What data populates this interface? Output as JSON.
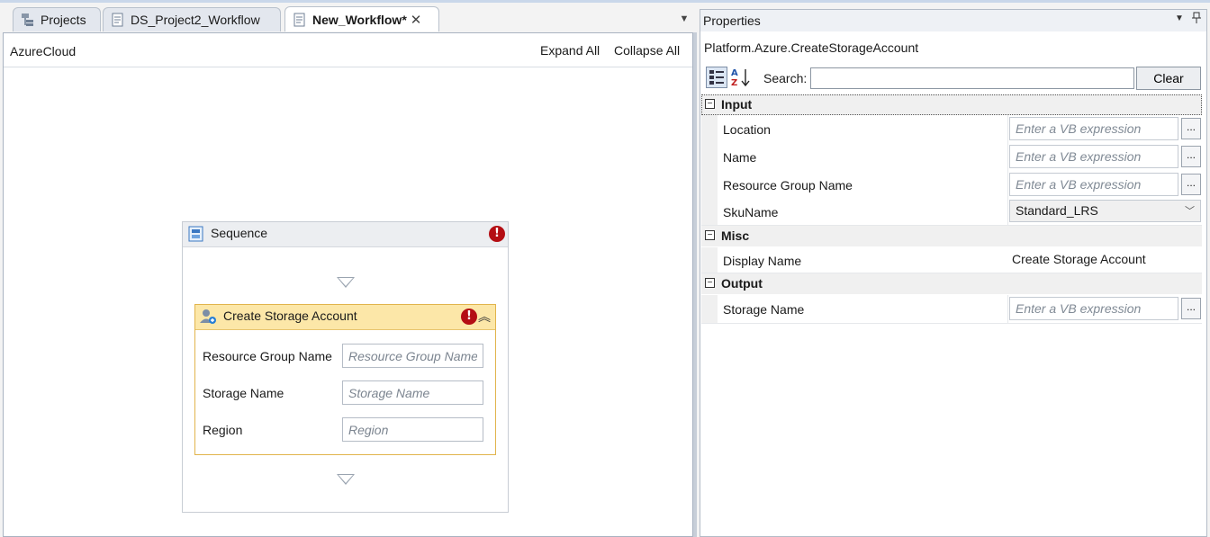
{
  "tabs": [
    {
      "label": "Projects",
      "icon": "project-explorer-icon",
      "active": false
    },
    {
      "label": "DS_Project2_Workflow",
      "icon": "workflow-document-icon",
      "active": false
    },
    {
      "label": "New_Workflow*",
      "icon": "workflow-document-icon",
      "active": true,
      "close": "✕"
    }
  ],
  "designer": {
    "breadcrumb": "AzureCloud",
    "expand_all": "Expand All",
    "collapse_all": "Collapse All",
    "sequence": {
      "title": "Sequence",
      "error_mark": "!",
      "activity": {
        "title": "Create Storage Account",
        "error_mark": "!",
        "collapse_glyph": "︽",
        "fields": [
          {
            "label": "Resource Group Name",
            "placeholder": "Resource Group Name"
          },
          {
            "label": "Storage Name",
            "placeholder": "Storage Name"
          },
          {
            "label": "Region",
            "placeholder": "Region"
          }
        ]
      }
    }
  },
  "properties": {
    "title": "Properties",
    "dropdown_glyph": "▼",
    "pin_glyph": "📌",
    "type_name": "Platform.Azure.CreateStorageAccount",
    "search_label": "Search:",
    "search_value": "",
    "clear_label": "Clear",
    "expand_glyph": "−",
    "ellipsis": "...",
    "categories": [
      {
        "name": "Input",
        "properties": [
          {
            "name": "Location",
            "placeholder": "Enter a VB expression"
          },
          {
            "name": "Name",
            "placeholder": "Enter a VB expression"
          },
          {
            "name": "Resource Group Name",
            "placeholder": "Enter a VB expression"
          },
          {
            "name": "SkuName",
            "value": "Standard_LRS"
          }
        ]
      },
      {
        "name": "Misc",
        "properties": [
          {
            "name": "Display Name",
            "value": "Create Storage Account"
          }
        ]
      },
      {
        "name": "Output",
        "properties": [
          {
            "name": "Storage Name",
            "placeholder": "Enter a VB expression"
          }
        ]
      }
    ]
  }
}
